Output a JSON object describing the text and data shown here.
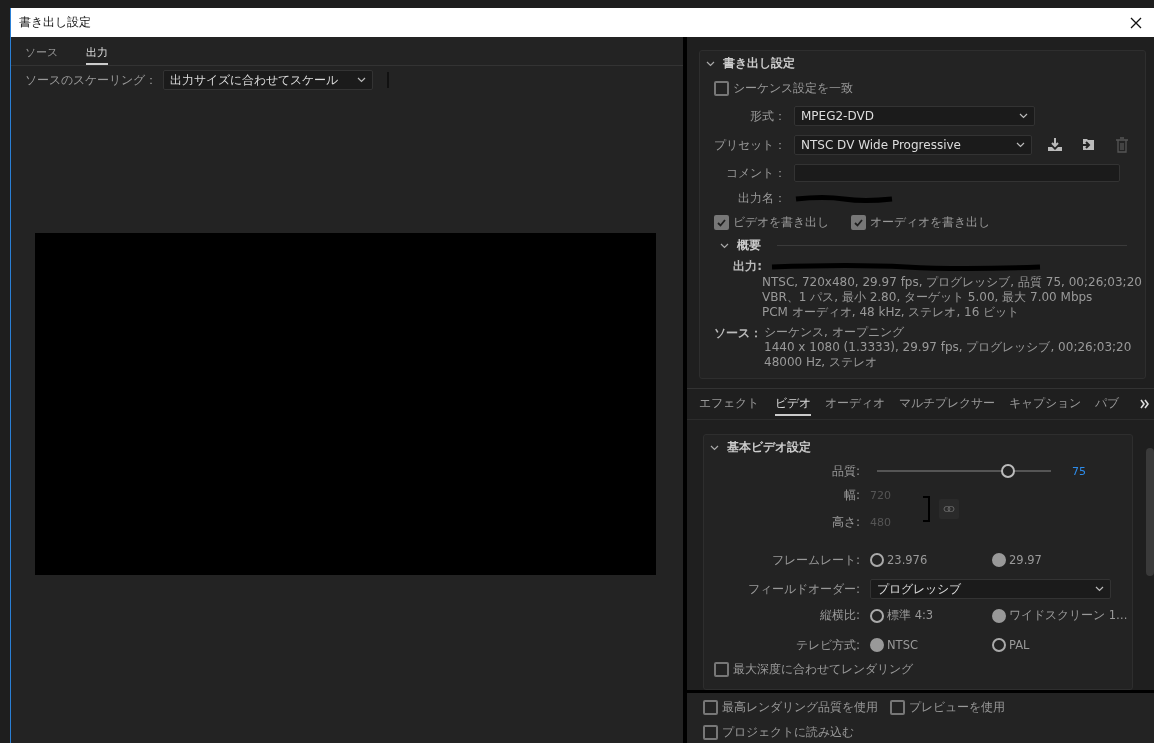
{
  "window": {
    "title": "書き出し設定"
  },
  "left": {
    "tabs": [
      {
        "label": "ソース",
        "selected": false
      },
      {
        "label": "出力",
        "selected": true
      }
    ],
    "scaling": {
      "label": "ソースのスケーリング：",
      "value": "出力サイズに合わせてスケール"
    }
  },
  "export_settings": {
    "title": "書き出し設定",
    "expanded": true,
    "match_sequence": {
      "label": "シーケンス設定を一致",
      "checked": false
    },
    "format": {
      "label": "形式：",
      "value": "MPEG2-DVD"
    },
    "preset": {
      "label": "プリセット：",
      "value": "NTSC DV Wide Progressive"
    },
    "comment": {
      "label": "コメント："
    },
    "output_name": {
      "label": "出力名："
    },
    "export_video": {
      "label": "ビデオを書き出し",
      "checked": true
    },
    "export_audio": {
      "label": "オーディオを書き出し",
      "checked": true
    },
    "summary": {
      "title": "概要",
      "expanded": true,
      "output": {
        "label": "出力:",
        "lines": [
          "NTSC, 720x480, 29.97 fps, プログレッシブ, 品質 75, 00;26;03;20",
          "VBR、1 パス, 最小 2.80, ターゲット 5.00, 最大 7.00 Mbps",
          "PCM オーディオ, 48 kHz, ステレオ, 16 ビット"
        ]
      },
      "source": {
        "label": "ソース：",
        "lines": [
          "シーケンス, オープニング",
          "1440 x 1080 (1.3333), 29.97 fps, プログレッシブ, 00;26;03;20",
          "48000  Hz, ステレオ"
        ]
      }
    }
  },
  "settings_tabs": [
    {
      "label": "エフェクト",
      "selected": false
    },
    {
      "label": "ビデオ",
      "selected": true
    },
    {
      "label": "オーディオ",
      "selected": false
    },
    {
      "label": "マルチプレクサー",
      "selected": false
    },
    {
      "label": "キャプション",
      "selected": false
    },
    {
      "label": "パブ",
      "selected": false
    }
  ],
  "video": {
    "title": "基本ビデオ設定",
    "expanded": true,
    "quality": {
      "label": "品質:",
      "level": 0.75,
      "value": "75"
    },
    "width": {
      "label": "幅:",
      "value": "720"
    },
    "height": {
      "label": "高さ:",
      "value": "480"
    },
    "frame_rate": {
      "label": "フレームレート:",
      "options": [
        {
          "label": "23.976",
          "selected": false
        },
        {
          "label": "29.97",
          "selected": true
        }
      ]
    },
    "field_order": {
      "label": "フィールドオーダー:",
      "value": "プログレッシブ"
    },
    "aspect": {
      "label": "縦横比:",
      "options": [
        {
          "label": "標準 4:3",
          "selected": false
        },
        {
          "label": "ワイドスクリーン 1…",
          "selected": true
        }
      ]
    },
    "tv_standard": {
      "label": "テレビ方式:",
      "options": [
        {
          "label": "NTSC",
          "selected": true
        },
        {
          "label": "PAL",
          "selected": false
        }
      ]
    },
    "max_depth": {
      "label": "最大深度に合わせてレンダリング",
      "checked": false
    }
  },
  "footer": [
    {
      "label": "最高レンダリング品質を使用",
      "checked": false
    },
    {
      "label": "プレビューを使用",
      "checked": false
    },
    {
      "label": "プロジェクトに読み込む",
      "checked": false
    }
  ]
}
